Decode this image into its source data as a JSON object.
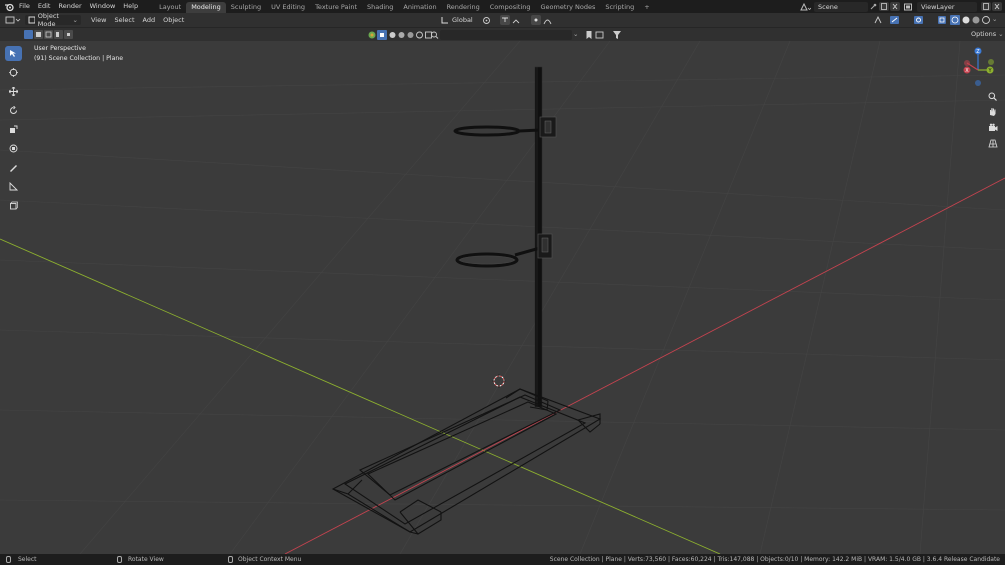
{
  "topbar": {
    "menus": [
      "File",
      "Edit",
      "Render",
      "Window",
      "Help"
    ],
    "workspaces": [
      {
        "label": "Layout",
        "active": false
      },
      {
        "label": "Modeling",
        "active": true
      },
      {
        "label": "Sculpting",
        "active": false
      },
      {
        "label": "UV Editing",
        "active": false
      },
      {
        "label": "Texture Paint",
        "active": false
      },
      {
        "label": "Shading",
        "active": false
      },
      {
        "label": "Animation",
        "active": false
      },
      {
        "label": "Rendering",
        "active": false
      },
      {
        "label": "Compositing",
        "active": false
      },
      {
        "label": "Geometry Nodes",
        "active": false
      },
      {
        "label": "Scripting",
        "active": false
      }
    ],
    "add_tab_label": "+",
    "scene_name": "Scene",
    "view_layer_name": "ViewLayer"
  },
  "header": {
    "mode_label": "Object Mode",
    "menus": [
      "View",
      "Select",
      "Add",
      "Object"
    ],
    "orientation_label": "Global",
    "options_label": "Options"
  },
  "viewport": {
    "view_name": "User Perspective",
    "collection_info": "(91) Scene Collection | Plane",
    "gizmo_axes": {
      "x": "X",
      "y": "Y",
      "z": "Z"
    }
  },
  "statusbar": {
    "left": [
      "Select",
      "Rotate View",
      "Object Context Menu"
    ],
    "stats": "Scene Collection | Plane | Verts:73,560 | Faces:60,224 | Tris:147,088 | Objects:0/10 | Memory: 142.2 MiB | VRAM: 1.5/4.0 GB | 3.6.4 Release Candidate"
  },
  "colors": {
    "accent": "#4772b3",
    "axis_x": "#c4434f",
    "axis_y": "#8db02f",
    "axis_z": "#3b7ad6",
    "viewport_bg": "#3b3b3b",
    "header_bg": "#303030"
  },
  "icons": [
    "blender-logo-icon",
    "select-box-icon",
    "cursor-icon",
    "move-icon",
    "rotate-icon",
    "scale-icon",
    "transform-icon",
    "annotate-icon",
    "measure-icon",
    "add-cube-icon",
    "zoom-icon",
    "hand-icon",
    "camera-icon",
    "grid-icon"
  ]
}
